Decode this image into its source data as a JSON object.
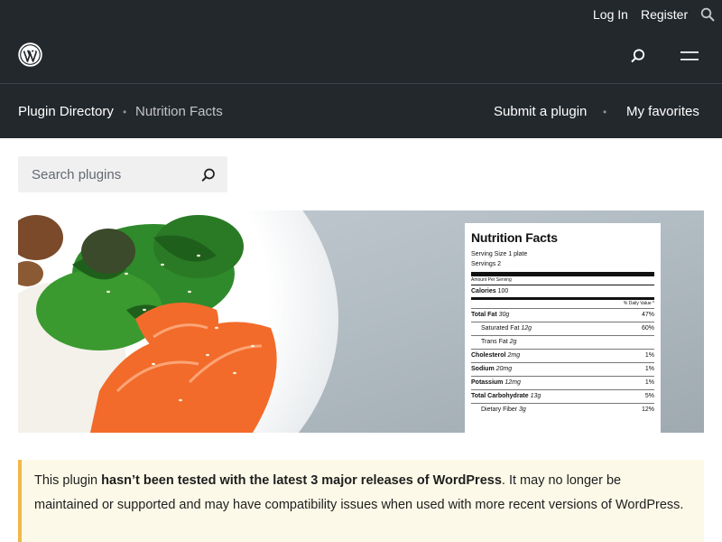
{
  "account": {
    "login_label": "Log In",
    "register_label": "Register",
    "search_icon": "search-icon"
  },
  "header": {
    "logo_icon": "wordpress-logo-icon",
    "search_icon": "search-icon",
    "menu_icon": "hamburger-menu-icon"
  },
  "subnav": {
    "breadcrumb_home": "Plugin Directory",
    "breadcrumb_separator": "•",
    "breadcrumb_current": "Nutrition Facts",
    "submit_label": "Submit a plugin",
    "nav_separator": "•",
    "favorites_label": "My favorites"
  },
  "search": {
    "placeholder": "Search plugins",
    "value": ""
  },
  "banner": {
    "label": {
      "title": "Nutrition Facts",
      "serving_size": "Serving Size  1 plate",
      "servings": "Servings  2",
      "amount_per_serving": "Amount Per Serving",
      "calories_label": "Calories",
      "calories_value": "100",
      "daily_value_header": "% Daily Value *",
      "rows": [
        {
          "name": "Total Fat",
          "amount": "30g",
          "dv": "47%",
          "bold": true,
          "indent": false
        },
        {
          "name": "Saturated Fat",
          "amount": "12g",
          "dv": "60%",
          "bold": false,
          "indent": true
        },
        {
          "name": "Trans Fat",
          "amount": "2g",
          "dv": "",
          "bold": false,
          "indent": true
        },
        {
          "name": "Cholesterol",
          "amount": "2mg",
          "dv": "1%",
          "bold": true,
          "indent": false
        },
        {
          "name": "Sodium",
          "amount": "20mg",
          "dv": "1%",
          "bold": true,
          "indent": false
        },
        {
          "name": "Potassium",
          "amount": "12mg",
          "dv": "1%",
          "bold": true,
          "indent": false
        },
        {
          "name": "Total Carbohydrate",
          "amount": "13g",
          "dv": "5%",
          "bold": true,
          "indent": false
        },
        {
          "name": "Dietary Fiber",
          "amount": "3g",
          "dv": "12%",
          "bold": false,
          "indent": true
        }
      ]
    }
  },
  "notice": {
    "prefix": "This plugin ",
    "emphasis": "hasn’t been tested with the latest 3 major releases of WordPress",
    "suffix": ". It may no longer be maintained or supported and may have compatibility issues when used with more recent versions of WordPress."
  },
  "colors": {
    "header_bg": "#23282d",
    "notice_bg": "#fcf9e8",
    "notice_border": "#f0b849",
    "search_bg": "#f0f0f1"
  }
}
